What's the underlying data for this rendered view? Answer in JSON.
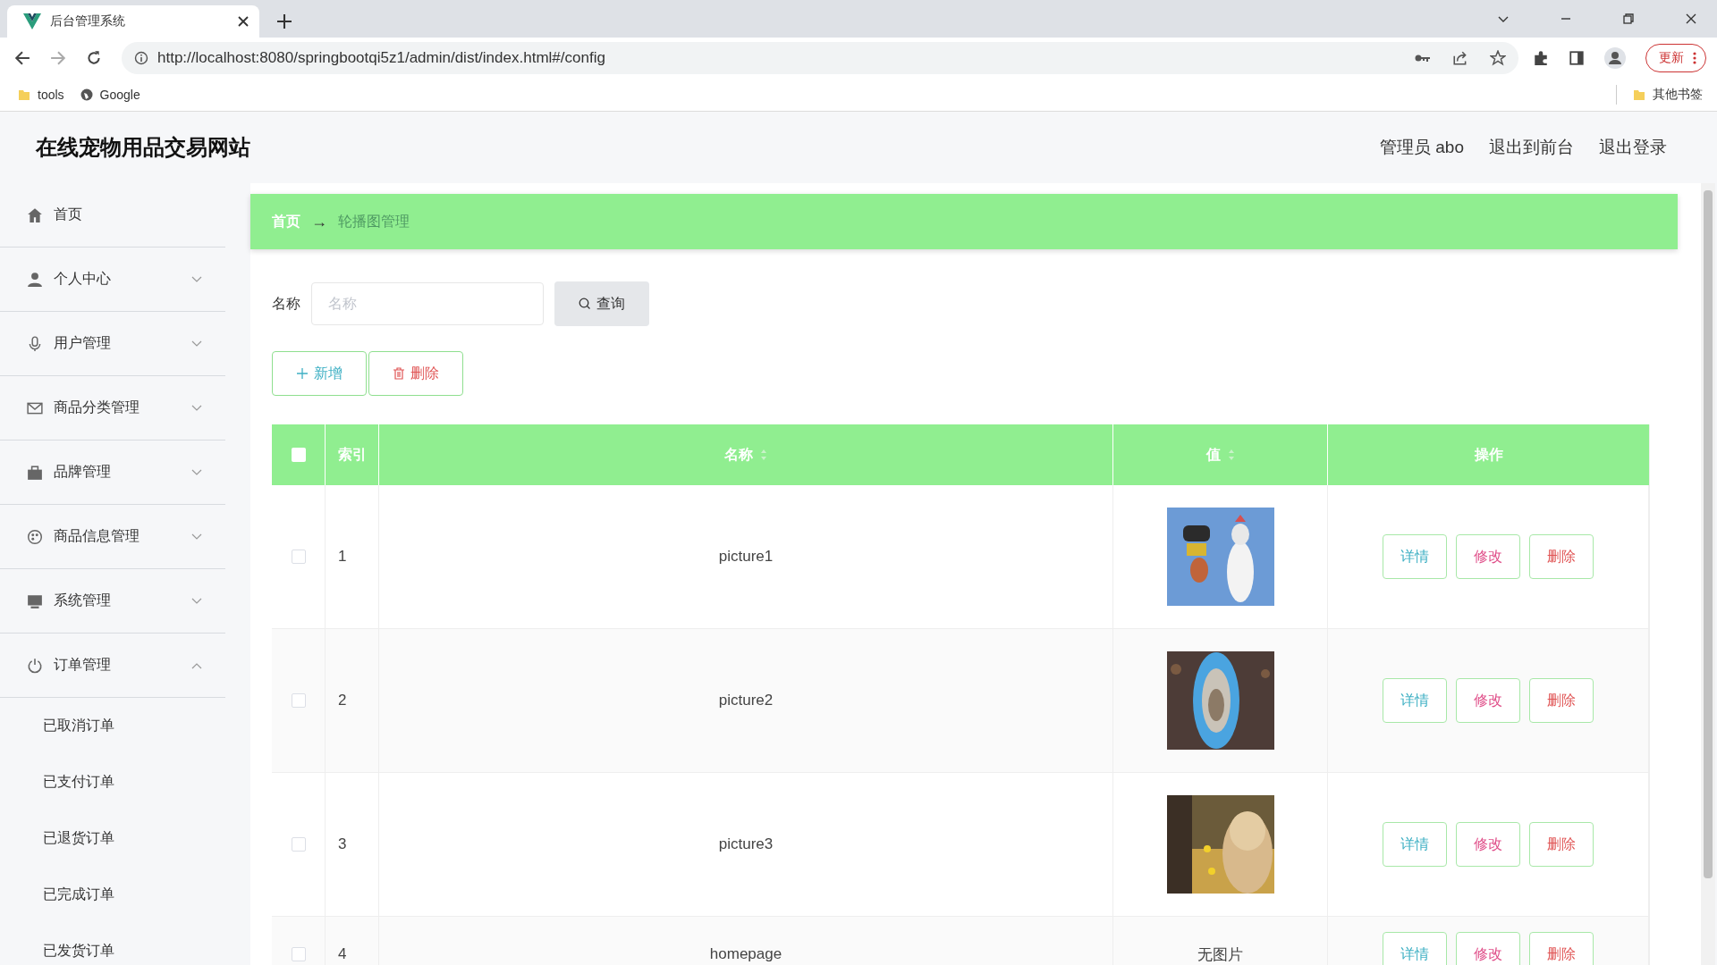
{
  "browser": {
    "tab_title": "后台管理系统",
    "url": "http://localhost:8080/springbootqi5z1/admin/dist/index.html#/config",
    "bookmarks": [
      "tools",
      "Google"
    ],
    "other_bookmarks": "其他书签",
    "update_button": "更新"
  },
  "header": {
    "site_title": "在线宠物用品交易网站",
    "links": [
      "管理员 abo",
      "退出到前台",
      "退出登录"
    ]
  },
  "sidebar": {
    "items": [
      {
        "label": "首页"
      },
      {
        "label": "个人中心",
        "expanded": false
      },
      {
        "label": "用户管理",
        "expanded": false
      },
      {
        "label": "商品分类管理",
        "expanded": false
      },
      {
        "label": "品牌管理",
        "expanded": false
      },
      {
        "label": "商品信息管理",
        "expanded": false
      },
      {
        "label": "系统管理",
        "expanded": false
      },
      {
        "label": "订单管理",
        "expanded": true,
        "children": [
          {
            "label": "已取消订单"
          },
          {
            "label": "已支付订单"
          },
          {
            "label": "已退货订单"
          },
          {
            "label": "已完成订单"
          },
          {
            "label": "已发货订单"
          }
        ]
      }
    ]
  },
  "breadcrumb": {
    "items": [
      "首页",
      "轮播图管理"
    ],
    "separator": "→"
  },
  "search": {
    "label": "名称",
    "placeholder": "名称",
    "button": "查询"
  },
  "actions": [
    {
      "kind": "add",
      "label": "新增"
    },
    {
      "kind": "delete",
      "label": "删除"
    }
  ],
  "table": {
    "columns": [
      {
        "kind": "checkbox",
        "checked": false
      },
      {
        "label": "索引",
        "sortable": false
      },
      {
        "label": "名称",
        "sortable": true
      },
      {
        "label": "值",
        "sortable": true
      },
      {
        "label": "操作",
        "sortable": false
      }
    ],
    "rows": [
      {
        "checked": false,
        "index": "1",
        "name": "picture1",
        "value": {
          "kind": "picture"
        },
        "actions": [
          {
            "kind": "detail",
            "label": "详情"
          },
          {
            "kind": "edit",
            "label": "修改"
          },
          {
            "kind": "delete",
            "label": "删除"
          }
        ]
      },
      {
        "checked": false,
        "index": "2",
        "name": "picture2",
        "value": {
          "kind": "picture"
        },
        "actions": [
          {
            "kind": "detail",
            "label": "详情"
          },
          {
            "kind": "edit",
            "label": "修改"
          },
          {
            "kind": "delete",
            "label": "删除"
          }
        ]
      },
      {
        "checked": false,
        "index": "3",
        "name": "picture3",
        "value": {
          "kind": "picture"
        },
        "actions": [
          {
            "kind": "detail",
            "label": "详情"
          },
          {
            "kind": "edit",
            "label": "修改"
          },
          {
            "kind": "delete",
            "label": "删除"
          }
        ]
      },
      {
        "checked": false,
        "index": "4",
        "name": "homepage",
        "value": {
          "kind": "text",
          "text": "无图片"
        },
        "actions": [
          {
            "kind": "detail",
            "label": "详情"
          },
          {
            "kind": "edit",
            "label": "修改"
          },
          {
            "kind": "delete",
            "label": "删除"
          }
        ]
      }
    ]
  }
}
